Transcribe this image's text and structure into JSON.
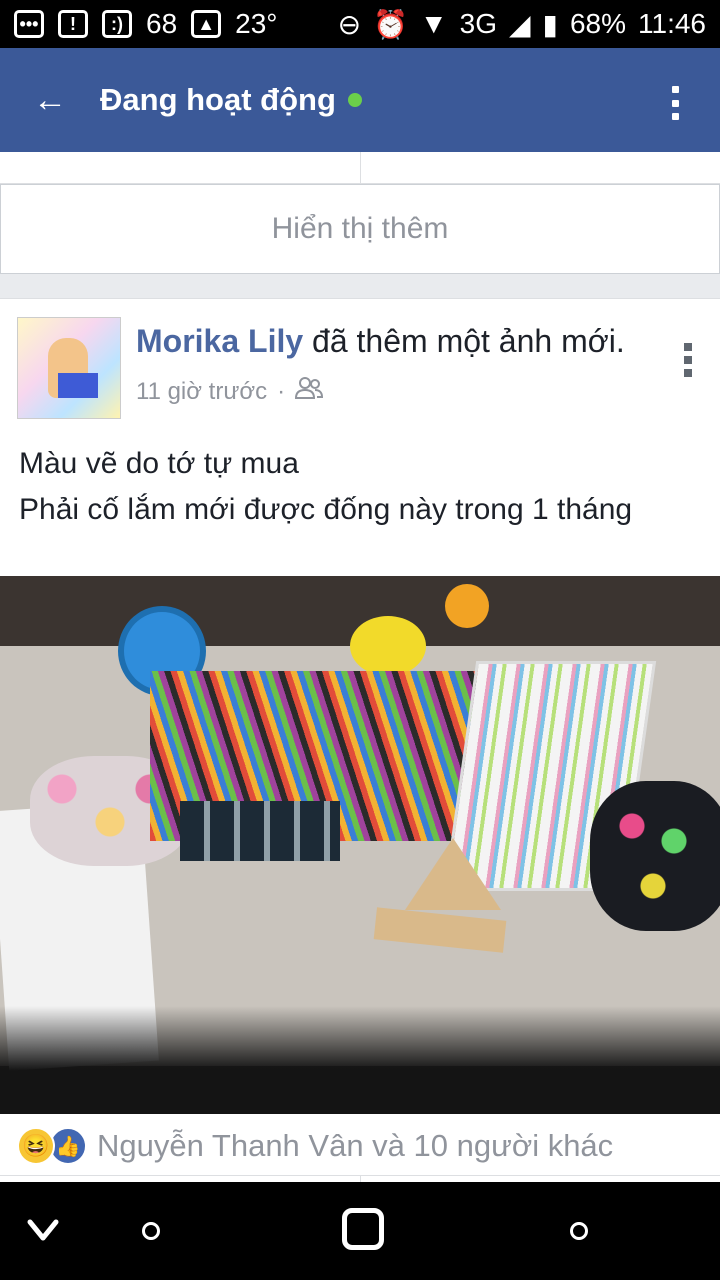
{
  "status_bar": {
    "weather_pct": "68",
    "temperature": "23°",
    "network": "3G",
    "battery": "68%",
    "time": "11:46"
  },
  "app_bar": {
    "title": "Đang hoạt động",
    "online_color": "#6bcf4a"
  },
  "show_more": {
    "label": "Hiển thị thêm"
  },
  "post": {
    "author": "Morika Lily",
    "action_text": "đã thêm một ảnh mới.",
    "time": "11 giờ trước",
    "separator": "·",
    "audience_icon": "friends-icon",
    "text_line1": "Màu vẽ do tớ tự mua",
    "text_line2": "Phải cố lắm mới được đống này trong 1 tháng",
    "reactions_text": "Nguyễn Thanh Vân và 10 người khác"
  },
  "colors": {
    "brand": "#3b5998",
    "name_link": "#4b67a1",
    "muted": "#90949c"
  }
}
